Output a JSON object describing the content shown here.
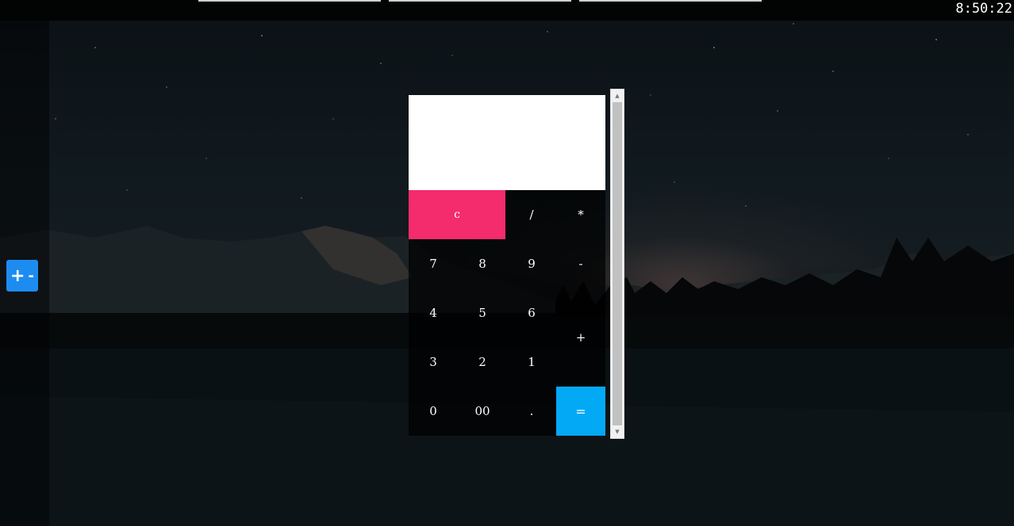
{
  "clock": {
    "time": "8:50:22"
  },
  "zoom_control": {
    "plus": "+",
    "minus": "-"
  },
  "calculator": {
    "display_value": "",
    "keys": {
      "clear": "c",
      "divide": "/",
      "multiply": "*",
      "seven": "7",
      "eight": "8",
      "nine": "9",
      "minus": "-",
      "four": "4",
      "five": "5",
      "six": "6",
      "plus": "+",
      "three": "3",
      "two": "2",
      "one": "1",
      "zero": "0",
      "double_zero": "00",
      "decimal": ".",
      "equals": "="
    },
    "colors": {
      "clear": "#f42b6c",
      "equals": "#03a9f4",
      "display_bg": "#ffffff"
    }
  },
  "scrollbar": {
    "up_icon": "triangle-up",
    "down_icon": "triangle-down"
  },
  "colors": {
    "zoom_button": "#1d8cf0",
    "topbar": "#020303"
  }
}
